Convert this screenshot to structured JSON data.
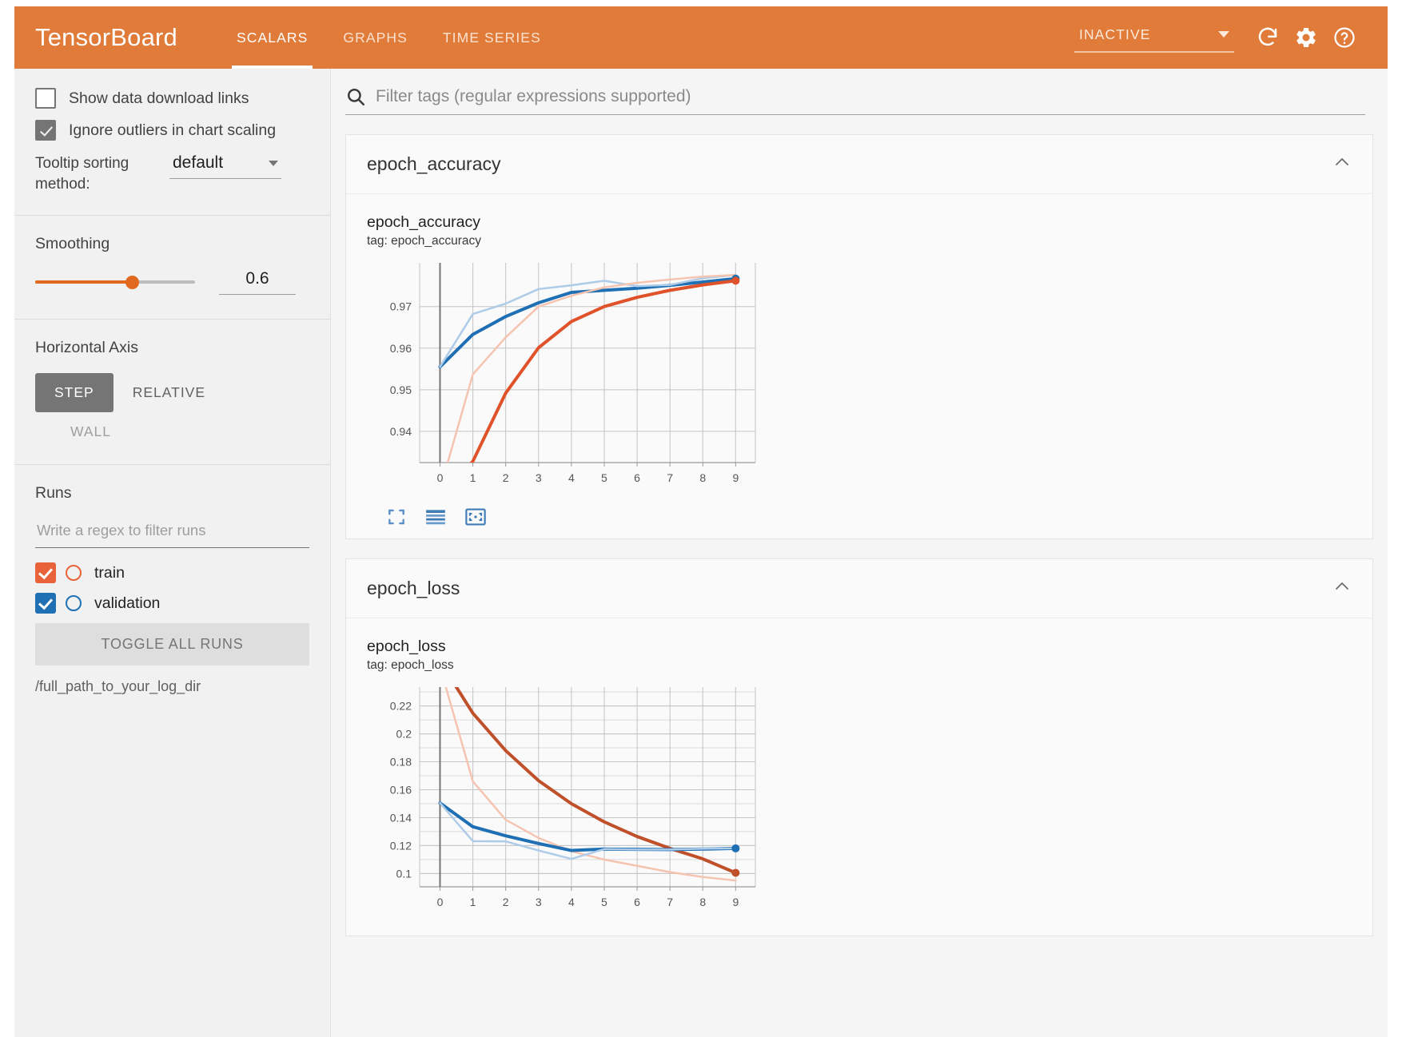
{
  "header": {
    "brand": "TensorBoard",
    "tabs": [
      {
        "label": "SCALARS",
        "active": true
      },
      {
        "label": "GRAPHS",
        "active": false
      },
      {
        "label": "TIME SERIES",
        "active": false
      }
    ],
    "run_selector": "INACTIVE",
    "icons": [
      "refresh-icon",
      "gear-icon",
      "help-icon"
    ],
    "bg_color": "#e07b39"
  },
  "sidebar": {
    "show_download_links": {
      "label": "Show data download links",
      "checked": false
    },
    "ignore_outliers": {
      "label": "Ignore outliers in chart scaling",
      "checked": true
    },
    "tooltip_sorting": {
      "label": "Tooltip sorting method:",
      "value": "default"
    },
    "smoothing": {
      "label": "Smoothing",
      "value": "0.6"
    },
    "horizontal_axis": {
      "label": "Horizontal Axis",
      "options": [
        "STEP",
        "RELATIVE",
        "WALL"
      ],
      "selected": "STEP"
    },
    "runs": {
      "label": "Runs",
      "filter_placeholder": "Write a regex to filter runs",
      "items": [
        {
          "name": "train",
          "checked": true,
          "color": "#e8633a"
        },
        {
          "name": "validation",
          "checked": true,
          "color": "#1f6fb4"
        }
      ],
      "toggle_all_label": "TOGGLE ALL RUNS",
      "logdir": "/full_path_to_your_log_dir"
    }
  },
  "main": {
    "filter_placeholder": "Filter tags (regular expressions supported)",
    "cards": [
      {
        "title": "epoch_accuracy",
        "chart_title": "epoch_accuracy",
        "chart_tag": "tag: epoch_accuracy",
        "collapse_icon": "chevron-up-icon",
        "tools": [
          "fullscreen-icon",
          "data-table-icon",
          "fit-domain-icon"
        ]
      },
      {
        "title": "epoch_loss",
        "chart_title": "epoch_loss",
        "chart_tag": "tag: epoch_loss",
        "collapse_icon": "chevron-up-icon",
        "tools": []
      }
    ]
  },
  "chart_data": [
    {
      "type": "line",
      "title": "epoch_accuracy",
      "tag": "tag: epoch_accuracy",
      "xlabel": "",
      "ylabel": "",
      "x": [
        0,
        1,
        2,
        3,
        4,
        5,
        6,
        7,
        8,
        9
      ],
      "xticks": [
        "0",
        "1",
        "2",
        "3",
        "4",
        "5",
        "6",
        "7",
        "8",
        "9"
      ],
      "yticks": [
        "0.94",
        "0.95",
        "0.96",
        "0.97"
      ],
      "ylim": [
        0.9325,
        0.9805
      ],
      "xlim": [
        -0.62,
        9.6
      ],
      "grid": true,
      "legend": "none",
      "series": [
        {
          "name": "validation (smoothed)",
          "color": "#1f6fb4",
          "width": 4,
          "values": [
            0.9555,
            0.9633,
            0.9676,
            0.9709,
            0.9734,
            0.9739,
            0.9744,
            0.9751,
            0.9759,
            0.9767
          ]
        },
        {
          "name": "validation (raw)",
          "color": "#aecbe8",
          "width": 2.5,
          "values": [
            0.9555,
            0.9682,
            0.9707,
            0.9742,
            0.9751,
            0.9762,
            0.9749,
            0.9752,
            0.9768,
            0.9776
          ]
        },
        {
          "name": "train (smoothed)",
          "color": "#e0522a",
          "width": 4,
          "values": [
            0.924,
            0.9328,
            0.9492,
            0.9601,
            0.9664,
            0.97,
            0.9722,
            0.9739,
            0.9752,
            0.9762
          ]
        },
        {
          "name": "train (raw)",
          "color": "#f5c4b1",
          "width": 2.5,
          "values": [
            0.926,
            0.9537,
            0.9626,
            0.97,
            0.9726,
            0.9746,
            0.9757,
            0.9765,
            0.9772,
            0.9776
          ]
        }
      ],
      "endpoints": [
        {
          "series": "validation (smoothed)",
          "x": 9,
          "y": 0.9767,
          "color": "#1f6fb4"
        },
        {
          "series": "train (smoothed)",
          "x": 9,
          "y": 0.9762,
          "color": "#e0522a"
        }
      ]
    },
    {
      "type": "line",
      "title": "epoch_loss",
      "tag": "tag: epoch_loss",
      "xlabel": "",
      "ylabel": "",
      "x": [
        0,
        1,
        2,
        3,
        4,
        5,
        6,
        7,
        8,
        9
      ],
      "xticks": [
        "0",
        "1",
        "2",
        "3",
        "4",
        "5",
        "6",
        "7",
        "8",
        "9"
      ],
      "yticks": [
        "0.22",
        "0.2",
        "0.18",
        "0.16",
        "0.14",
        "0.12",
        "0.1"
      ],
      "ylim": [
        0.0905,
        0.2335
      ],
      "xlim": [
        -0.62,
        9.6
      ],
      "grid": true,
      "legend": "none",
      "series": [
        {
          "name": "train (smoothed)",
          "color": "#c0502a",
          "width": 4,
          "values": [
            0.252,
            0.2148,
            0.188,
            0.1665,
            0.15,
            0.137,
            0.1265,
            0.118,
            0.1105,
            0.1005
          ]
        },
        {
          "name": "train (raw)",
          "color": "#f5c4b1",
          "width": 2.5,
          "values": [
            0.248,
            0.166,
            0.1385,
            0.1255,
            0.116,
            0.11,
            0.1055,
            0.101,
            0.0975,
            0.095
          ]
        },
        {
          "name": "validation (smoothed)",
          "color": "#1f6fb4",
          "width": 4,
          "values": [
            0.1505,
            0.1335,
            0.127,
            0.1215,
            0.1165,
            0.1175,
            0.1173,
            0.1172,
            0.1175,
            0.118
          ]
        },
        {
          "name": "validation (raw)",
          "color": "#aecbe8",
          "width": 2.5,
          "values": [
            0.1505,
            0.1232,
            0.123,
            0.1165,
            0.1105,
            0.1175,
            0.1172,
            0.1172,
            0.1178,
            0.118
          ]
        }
      ],
      "endpoints": [
        {
          "series": "validation (smoothed)",
          "x": 9,
          "y": 0.118,
          "color": "#1f6fb4"
        },
        {
          "series": "train (smoothed)",
          "x": 9,
          "y": 0.1005,
          "color": "#c0502a"
        }
      ]
    }
  ]
}
